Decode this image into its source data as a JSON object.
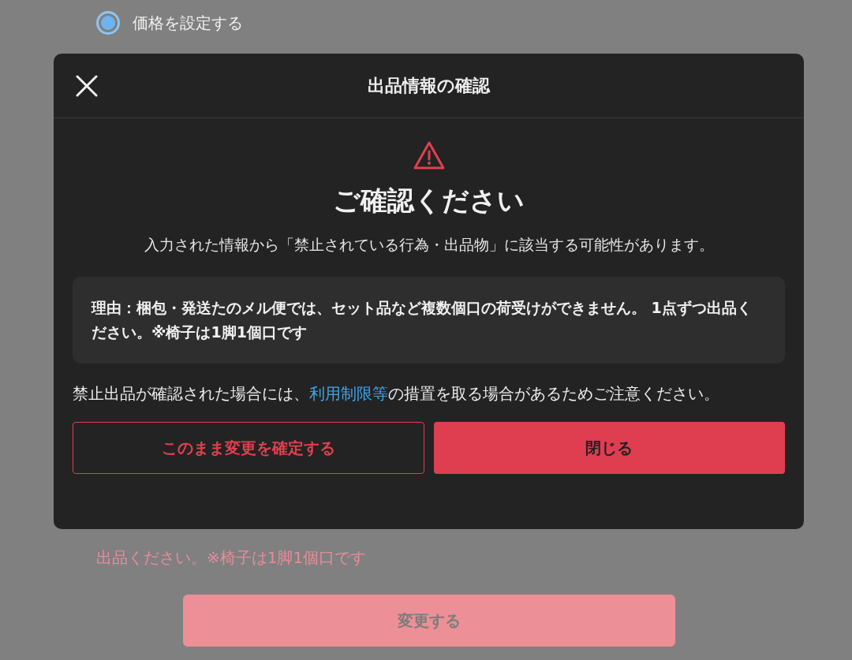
{
  "page": {
    "price_option": {
      "label": "価格を設定する",
      "selected": true
    },
    "error_text": "出品ください。※椅子は1脚1個口です",
    "submit_button": "変更する"
  },
  "dialog": {
    "title": "出品情報の確認",
    "heading": "ご確認ください",
    "message": "入力された情報から「禁止されている行為・出品物」に該当する可能性があります。",
    "reason": "理由：梱包・発送たのメル便では、セット品など複数個口の荷受けができません。 1点ずつ出品ください。※椅子は1脚1個口です",
    "notice": {
      "before": "禁止出品が確認された場合には、",
      "link": "利用制限等",
      "after": "の措置を取る場合があるためご注意ください。"
    },
    "buttons": [
      {
        "label": "このまま変更を確定する",
        "kind": "outline"
      },
      {
        "label": "閉じる",
        "kind": "filled"
      }
    ]
  }
}
